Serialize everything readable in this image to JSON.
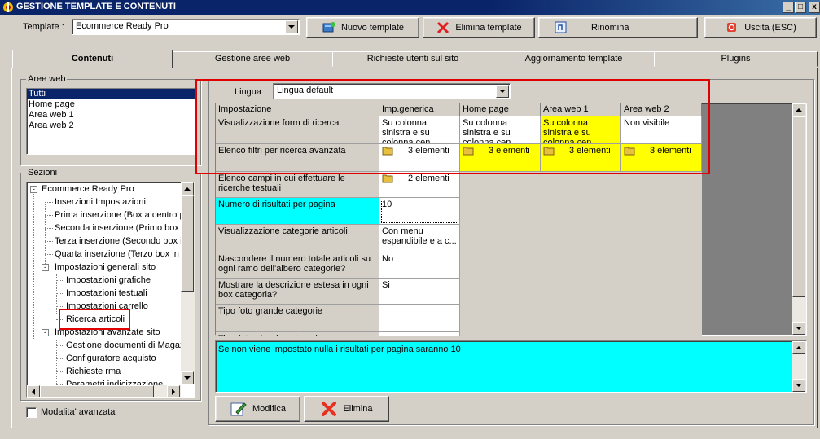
{
  "window": {
    "title": "GESTIONE TEMPLATE E CONTENUTI"
  },
  "toolbar": {
    "template_label": "Template :",
    "template_value": "Ecommerce Ready Pro",
    "new_template": "Nuovo template",
    "delete_template": "Elimina template",
    "rename": "Rinomina",
    "exit": "Uscita (ESC)"
  },
  "tabs": [
    "Contenuti",
    "Gestione aree web",
    "Richieste utenti sul sito",
    "Aggiornamento template",
    "Plugins"
  ],
  "web_areas": {
    "legend": "Aree web",
    "items": [
      "Tutti",
      "Home page",
      "Area web 1",
      "Area web 2"
    ]
  },
  "sections": {
    "legend": "Sezioni",
    "tree": [
      "Ecommerce Ready Pro",
      "Inserzioni Impostazioni",
      "Prima inserzione (Box a centro pa",
      "Seconda inserzione (Primo box in",
      "Terza inserzione (Secondo box in",
      "Quarta inserzione (Terzo box in b",
      "Impostazioni generali sito",
      "Impostazioni grafiche",
      "Impostazioni testuali",
      "Impostazioni carrello",
      "Ricerca articoli",
      "Impostazioni avanzate sito",
      "Gestione documenti di Magaz",
      "Configuratore acquisto",
      "Richieste rma",
      "Parametri indicizzazione"
    ]
  },
  "advanced_mode": "Modalita' avanzata",
  "language": {
    "label": "Lingua :",
    "value": "Lingua default"
  },
  "grid": {
    "headers": [
      "Impostazione",
      "Imp.generica",
      "Home page",
      "Area web 1",
      "Area web 2"
    ],
    "rows": [
      [
        "Visualizzazione form di ricerca",
        "Su colonna sinistra e su colonna cen...",
        "Su colonna sinistra e su colonna cen...",
        "Su colonna sinistra e su colonna cen...",
        "Non visibile"
      ],
      [
        "Elenco filtri per ricerca avanzata",
        "3 elementi",
        "3 elementi",
        "3 elementi",
        "3 elementi"
      ],
      [
        "Elenco campi in cui effettuare le ricerche testuali",
        "2 elementi"
      ],
      [
        "Numero di risultati per pagina",
        "10"
      ],
      [
        "Visualizzazione categorie articoli",
        "Con menu espandibile e a c..."
      ],
      [
        "Nascondere il numero totale articoli su ogni ramo dell'albero categorie?",
        "No"
      ],
      [
        "Mostrare la descrizione estesa in ogni box categoria?",
        "Si"
      ],
      [
        "Tipo foto grande categorie",
        ""
      ],
      [
        "Tipo foto piccola categorie",
        ""
      ]
    ]
  },
  "description": "Se non viene impostato nulla i risultati per pagina saranno 10",
  "actions": {
    "edit": "Modifica",
    "delete": "Elimina"
  }
}
